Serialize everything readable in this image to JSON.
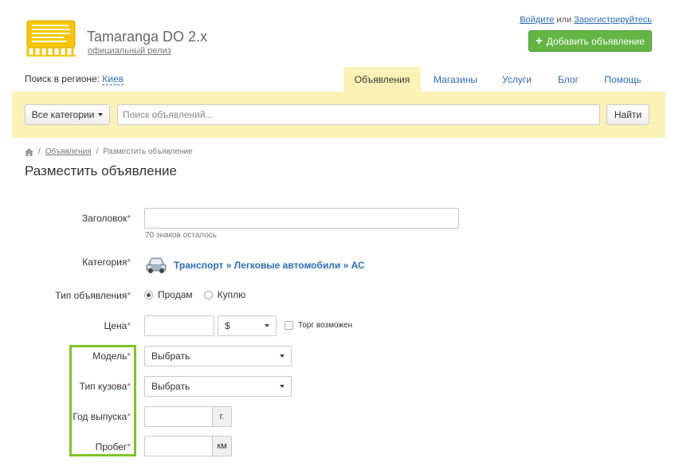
{
  "colors": {
    "accent_green": "#64b544",
    "link_blue": "#2a6db8",
    "highlight_yellow": "#fcf2b6",
    "annotation_green": "#7dc624",
    "logo_yellow": "#f7c600"
  },
  "header": {
    "logo_title": "Tamaranga DO 2.x",
    "logo_subtitle": "официальный релиз",
    "auth": {
      "login": "Войдите",
      "or": "или",
      "register": "Зарегистрируйтесь"
    },
    "add_button": "Добавить объявление"
  },
  "region": {
    "label": "Поиск в регионе:",
    "city": "Киев"
  },
  "nav": {
    "tabs": [
      {
        "label": "Объявления",
        "active": true
      },
      {
        "label": "Магазины"
      },
      {
        "label": "Услуги"
      },
      {
        "label": "Блог"
      },
      {
        "label": "Помощь"
      }
    ]
  },
  "search": {
    "categories_button": "Все категории",
    "placeholder": "Поиск объявлений...",
    "find_button": "Найти"
  },
  "breadcrumb": {
    "items": [
      "Объявления",
      "Разместить объявление"
    ]
  },
  "page": {
    "title": "Разместить объявление"
  },
  "form": {
    "title_label": "Заголовок",
    "title_hint": "70 знаков осталось",
    "category_label": "Категория",
    "category_path": "Транспорт » Легковые автомобили » АС",
    "type_label": "Тип объявления",
    "type_options": [
      "Продам",
      "Куплю"
    ],
    "price_label": "Цена",
    "currency": "$",
    "bargain_label": "Торг возможен",
    "model_label": "Модель",
    "model_value": "Выбрать",
    "body_label": "Тип кузова",
    "body_value": "Выбрать",
    "year_label": "Год выпуска",
    "year_unit": "г.",
    "mileage_label": "Пробег",
    "mileage_unit": "км",
    "required_mark": "*"
  }
}
